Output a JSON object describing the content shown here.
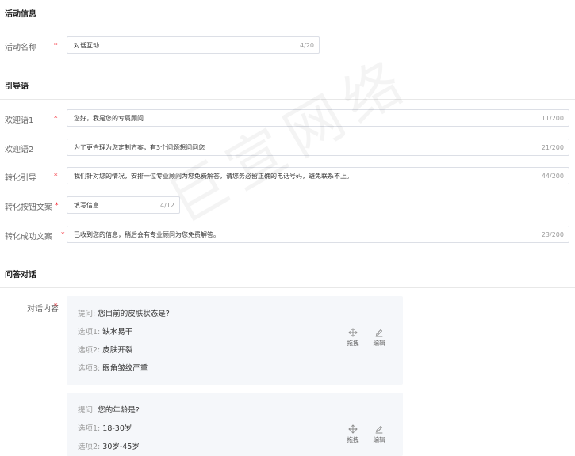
{
  "sections": {
    "activity_info": "活动信息",
    "guide": "引导语",
    "qa": "问答对话"
  },
  "activity_name": {
    "label": "活动名称",
    "value": "对话互动",
    "count": "4/20"
  },
  "guide_fields": [
    {
      "label": "欢迎语1",
      "value": "您好，我是您的专属顾问",
      "count": "11/200",
      "required": true
    },
    {
      "label": "欢迎语2",
      "value": "为了更合理为您定制方案，有3个问题想问问您",
      "count": "21/200",
      "required": false
    },
    {
      "label": "转化引导",
      "value": "我们针对您的情况，安排一位专业顾问为您免费解答，请您务必留正确的电话号码，避免联系不上。",
      "count": "44/200",
      "required": true
    },
    {
      "label": "转化按钮文案",
      "value": "填写信息",
      "count": "4/12",
      "required": true
    },
    {
      "label": "转化成功文案",
      "value": "已收到您的信息，稍后会有专业顾问为您免费解答。",
      "count": "23/200",
      "required": true
    }
  ],
  "dialog": {
    "label": "对话内容",
    "cards": [
      {
        "question_prefix": "提问:",
        "question": "您目前的皮肤状态是?",
        "options": [
          {
            "prefix": "选项1:",
            "text": "缺水易干"
          },
          {
            "prefix": "选项2:",
            "text": "皮肤开裂"
          },
          {
            "prefix": "选项3:",
            "text": "眼角皱纹严重"
          }
        ]
      },
      {
        "question_prefix": "提问:",
        "question": "您的年龄是?",
        "options": [
          {
            "prefix": "选项1:",
            "text": "18-30岁"
          },
          {
            "prefix": "选项2:",
            "text": "30岁-45岁"
          }
        ]
      }
    ],
    "actions": {
      "drag": "拖拽",
      "edit": "编辑"
    }
  },
  "required_mark": "*",
  "watermark": "巨宣网络",
  "colors": {
    "required": "#f5222d",
    "card_bg": "#f5f7fa",
    "border": "#dcdfe6"
  }
}
